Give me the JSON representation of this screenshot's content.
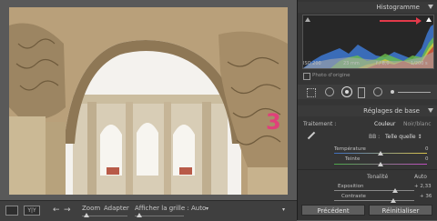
{
  "panel": {
    "histogram_title": "Histogramme",
    "exif": {
      "iso": "ISO 200",
      "focal": "23 mm",
      "aperture": "f / 8,0",
      "shutter": "1/200 s"
    },
    "original_photo": "Photo d'origine",
    "basic_title": "Réglages de base",
    "treatment_label": "Traitement :",
    "treatment_color": "Couleur",
    "treatment_bw": "Noir/blanc",
    "wb_label": "BB :",
    "wb_value": "Telle quelle ↕",
    "temperature_label": "Température",
    "temperature_value": "0",
    "tint_label": "Teinte",
    "tint_value": "0",
    "tone_label": "Tonalité",
    "tone_auto": "Auto",
    "exposure_label": "Exposition",
    "exposure_value": "+ 2,33",
    "contrast_label": "Contraste",
    "contrast_value": "+ 36",
    "prev_button": "Précédent",
    "reset_button": "Réinitialiser"
  },
  "toolbar": {
    "zoom_label": "Zoom",
    "zoom_value": "Adapter",
    "grid_label": "Afficher la grille :",
    "grid_value": "Auto"
  },
  "annotation": {
    "number": "3",
    "color": "#e0407a"
  }
}
